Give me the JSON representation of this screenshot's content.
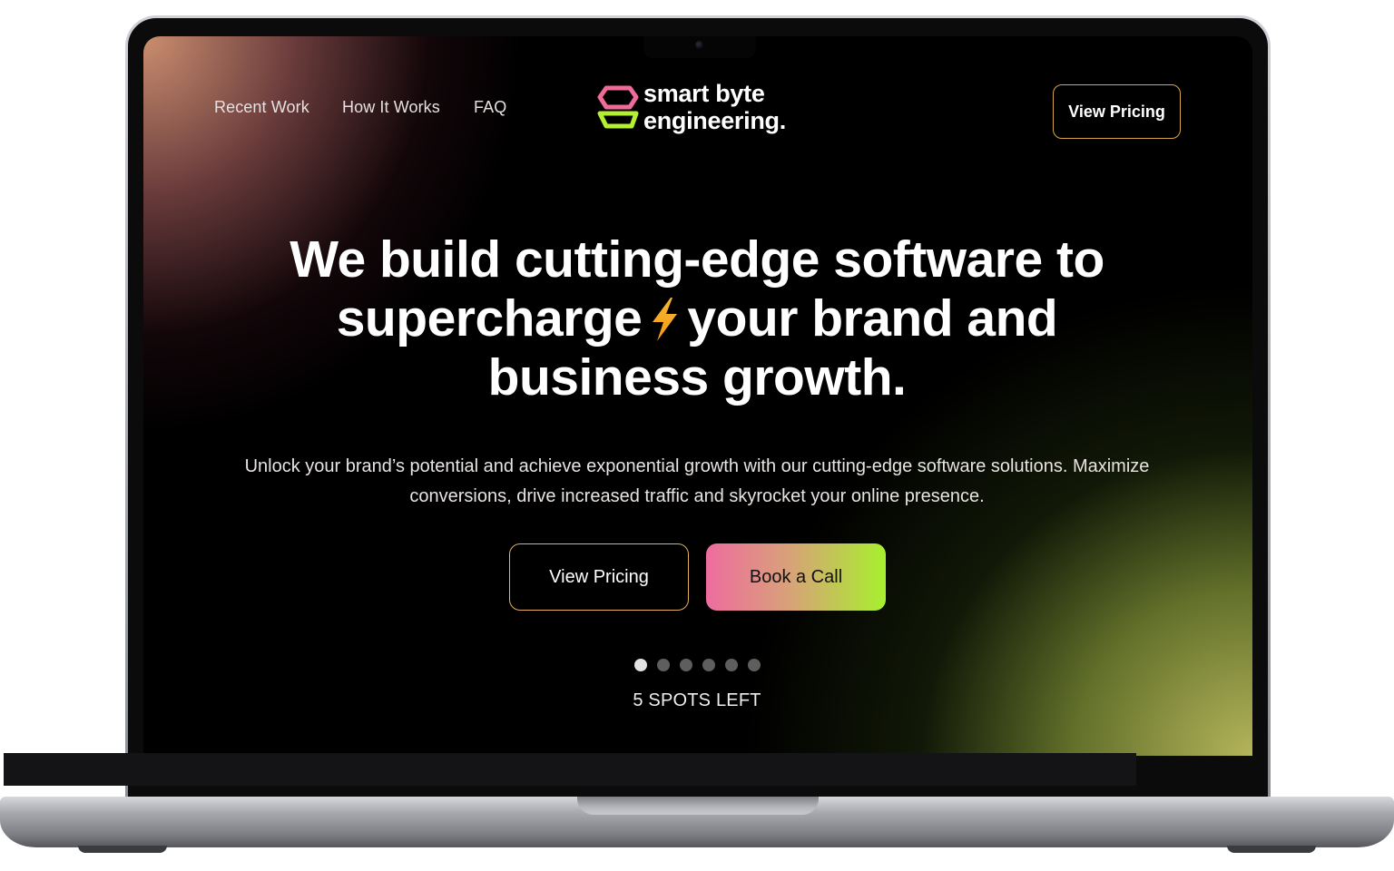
{
  "nav": {
    "links": [
      "Recent Work",
      "How It Works",
      "FAQ"
    ],
    "cta_label": "View Pricing"
  },
  "logo": {
    "line1": "smart byte",
    "line2": "engineering."
  },
  "hero": {
    "title_part1": "We build cutting-edge software to supercharge",
    "title_part2": "your brand and business growth.",
    "subtitle": "Unlock your brand’s potential and achieve exponential growth with our cutting-edge software solutions. Maximize conversions, drive increased traffic and skyrocket your online presence.",
    "primary_button": "View Pricing",
    "secondary_button": "Book a Call"
  },
  "carousel": {
    "dot_count": 6,
    "active_index": 0
  },
  "availability": "5 SPOTS LEFT",
  "colors": {
    "accent_gold": "#d6a84a",
    "gradient_pink": "#ee6c9e",
    "gradient_green": "#a8f02e",
    "logo_pink": "#f06a9a",
    "logo_green": "#b4f032"
  },
  "icons": [
    "smart-byte-logo-icon",
    "lightning-bolt-icon"
  ]
}
